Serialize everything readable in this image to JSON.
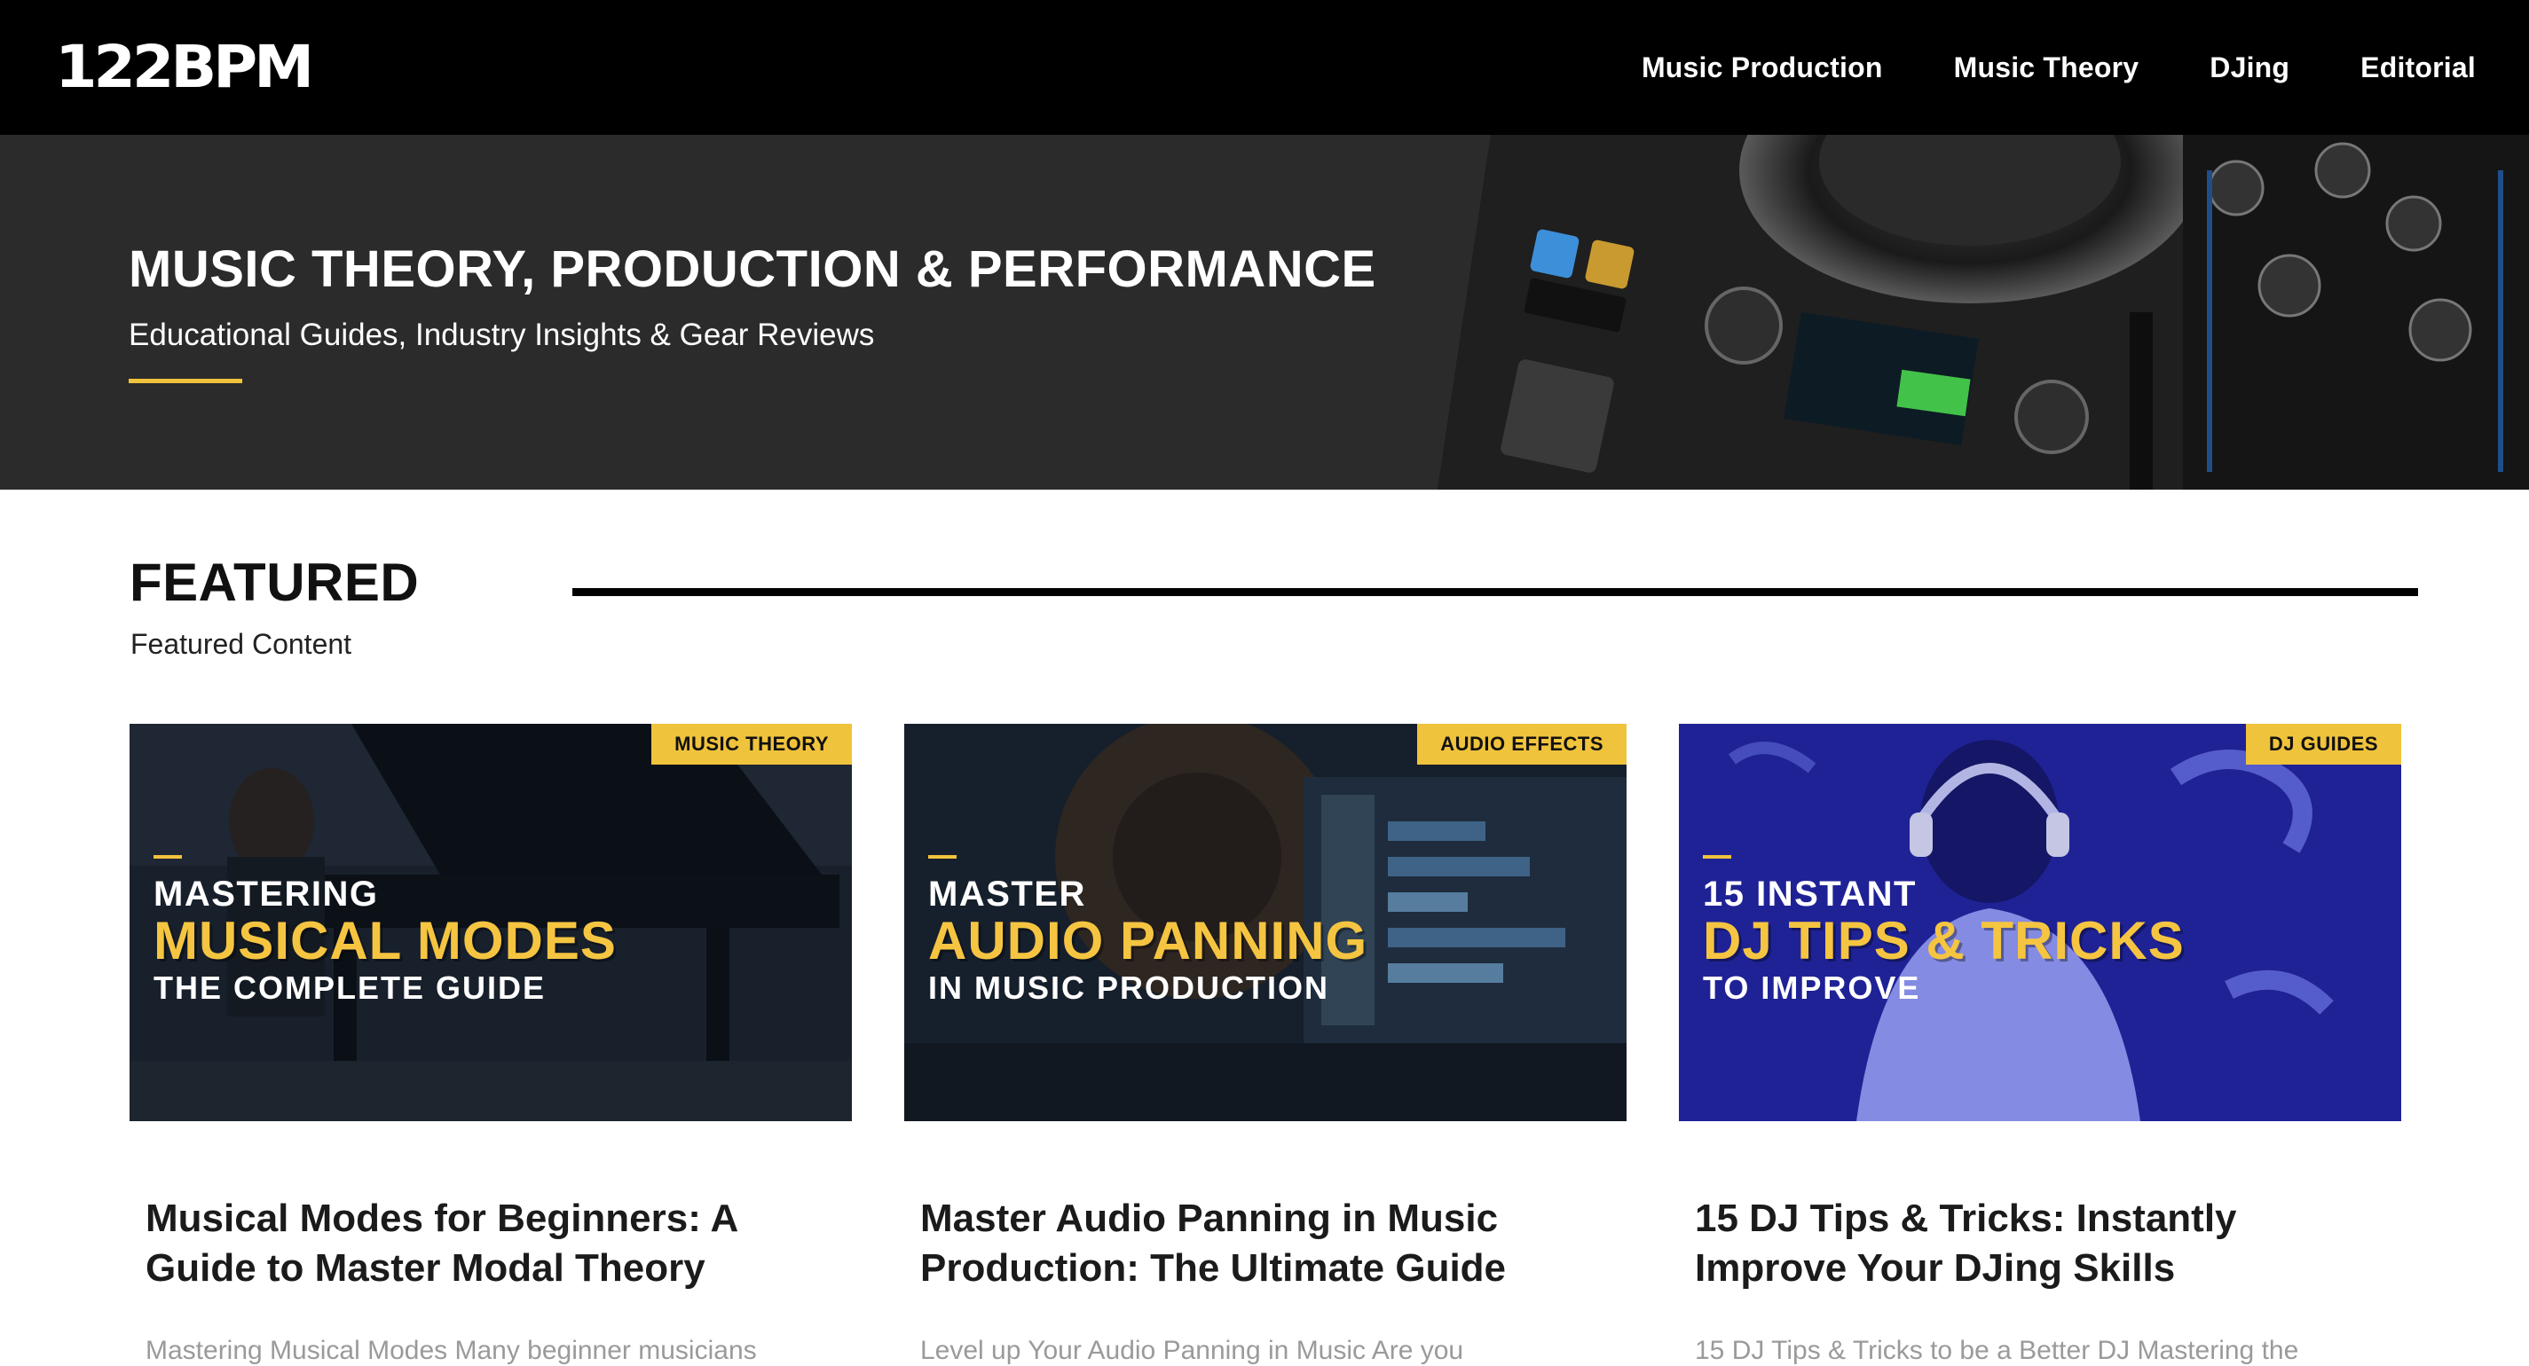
{
  "brand": {
    "logo_text": "122BPM"
  },
  "nav": {
    "items": [
      "Music Production",
      "Music Theory",
      "DJing",
      "Editorial"
    ]
  },
  "hero": {
    "title": "MUSIC THEORY, PRODUCTION & PERFORMANCE",
    "subtitle": "Educational Guides, Industry Insights & Gear Reviews",
    "image": "dj-controller-photo"
  },
  "featured": {
    "title": "FEATURED",
    "subtitle": "Featured Content"
  },
  "cards": [
    {
      "category": "MUSIC THEORY",
      "overlay_line1": "MASTERING",
      "overlay_line2": "MUSICAL MODES",
      "overlay_line3": "THE COMPLETE GUIDE",
      "title": "Musical Modes for Beginners: A Guide to Master Modal Theory",
      "excerpt": "Mastering Musical Modes Many beginner musicians",
      "image": "pianist-at-grand-piano"
    },
    {
      "category": "AUDIO EFFECTS",
      "overlay_line1": "MASTER",
      "overlay_line2": "AUDIO PANNING",
      "overlay_line3": "IN MUSIC PRODUCTION",
      "title": "Master Audio Panning in Music Production: The Ultimate Guide",
      "excerpt": "Level up Your Audio Panning in Music Are you",
      "image": "studio-monitor-and-daw"
    },
    {
      "category": "DJ GUIDES",
      "overlay_line1": "15 INSTANT",
      "overlay_line2": "DJ TIPS & TRICKS",
      "overlay_line3": "TO IMPROVE",
      "title": "15 DJ Tips & Tricks: Instantly Improve Your DJing Skills",
      "excerpt": "15 DJ Tips & Tricks to be a Better DJ Mastering the",
      "image": "dj-with-headphones-neon"
    }
  ],
  "colors": {
    "accent": "#f0c33c",
    "topbar": "#000000",
    "hero_bg": "#2b2b2b"
  }
}
